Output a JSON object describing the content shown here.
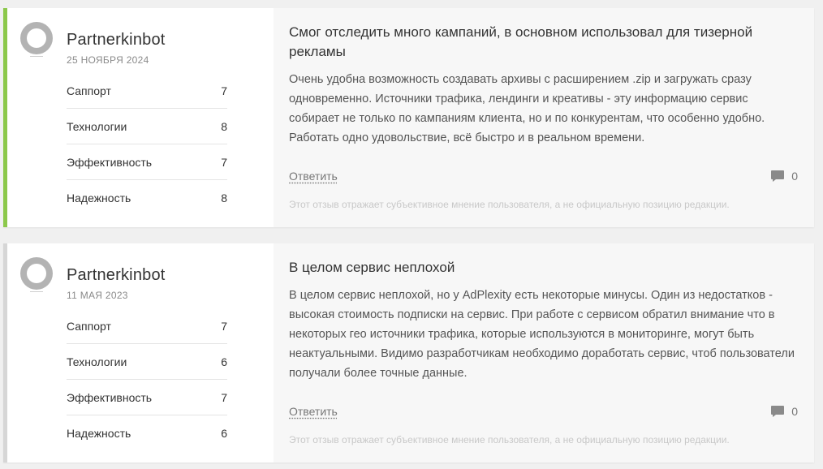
{
  "colors": {
    "accent_first": "#8cc84b",
    "accent_second": "#d6d6d6",
    "avatar": "#b3b3b3"
  },
  "reviews": [
    {
      "author": "Partnerkinbot",
      "date": "25 ноября 2024",
      "ratings": [
        {
          "label": "Саппорт",
          "value": "7"
        },
        {
          "label": "Технологии",
          "value": "8"
        },
        {
          "label": "Эффективность",
          "value": "7"
        },
        {
          "label": "Надежность",
          "value": "8"
        }
      ],
      "title": "Смог отследить много кампаний, в основном использовал для тизерной рекламы",
      "body": "Очень удобна возможность создавать архивы с расширением .zip и загружать сразу одновременно. Источники трафика, лендинги и креативы - эту информацию сервис собирает не только по кампаниям клиента, но и по конкурентам, что особенно удобно. Работать одно удовольствие, всё быстро и в реальном времени.",
      "reply_label": "Ответить",
      "comment_count": "0",
      "disclaimer": "Этот отзыв отражает субъективное мнение пользователя, а не официальную позицию редакции."
    },
    {
      "author": "Partnerkinbot",
      "date": "11 мая 2023",
      "ratings": [
        {
          "label": "Саппорт",
          "value": "7"
        },
        {
          "label": "Технологии",
          "value": "6"
        },
        {
          "label": "Эффективность",
          "value": "7"
        },
        {
          "label": "Надежность",
          "value": "6"
        }
      ],
      "title": "В целом сервис неплохой",
      "body": "В целом сервис неплохой, но у AdPlexity есть некоторые минусы. Один из недостатков - высокая стоимость подписки на сервис. При работе с сервисом обратил внимание что в некоторых гео источники трафика, которые используются в мониторинге, могут быть неактуальными. Видимо разработчикам необходимо доработать сервис, чтоб пользователи получали более точные данные.",
      "reply_label": "Ответить",
      "comment_count": "0",
      "disclaimer": "Этот отзыв отражает субъективное мнение пользователя, а не официальную позицию редакции."
    }
  ]
}
